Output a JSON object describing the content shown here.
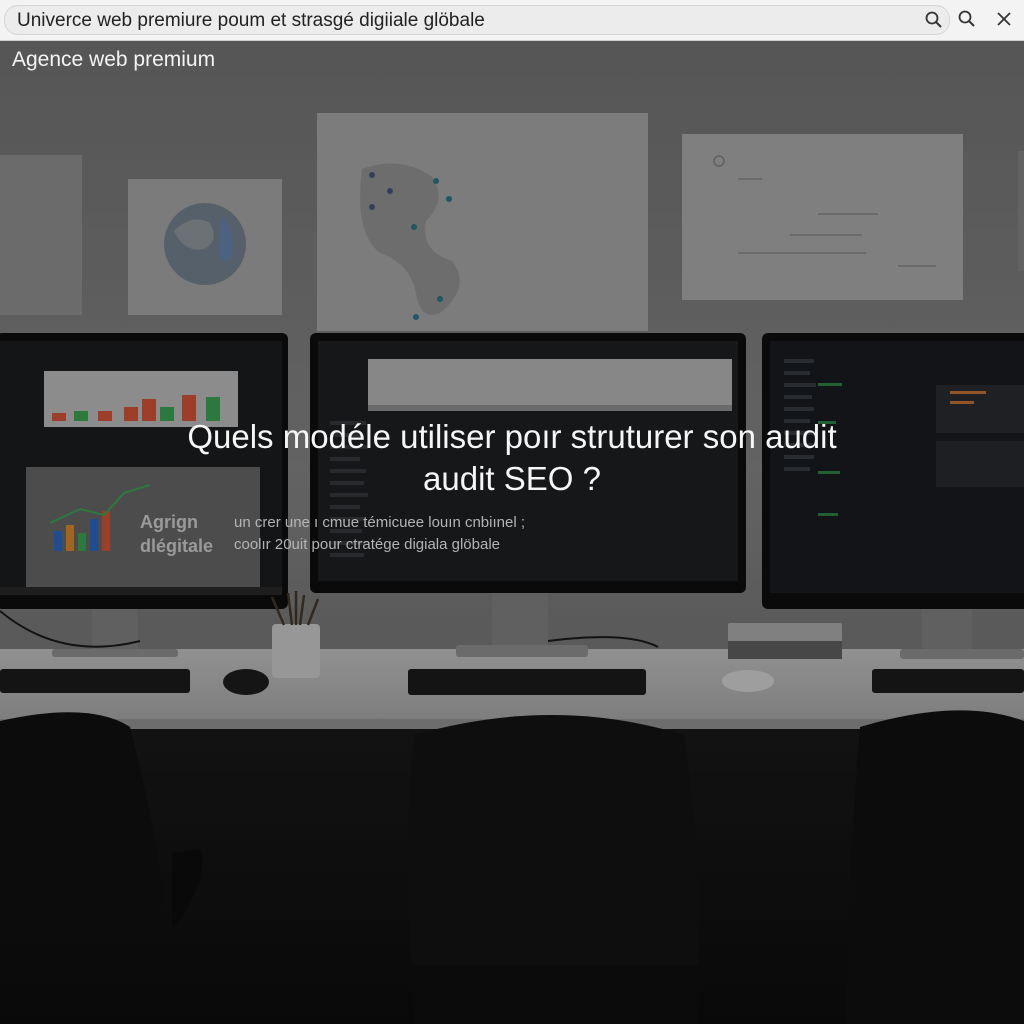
{
  "search": {
    "value": "Univerce web premiure poum et strasgé digiiale glöbale"
  },
  "icons": {
    "search_inline": "search-icon",
    "search_button": "search-icon",
    "close": "close-icon"
  },
  "hero": {
    "brand": "Agence web premium",
    "headline_line1": "Quels modéle utiliser poır struturer son audit",
    "headline_line2": "audit SEO ?",
    "panel_title_line1": "Agrign",
    "panel_title_line2": "dlégitale",
    "panel_sub_line1": "un crer une ı cmue témicuee louın cnbiınel ;",
    "panel_sub_line2": "coolır 20uit    pour ctratége digiala glöbale"
  },
  "colors": {
    "topbar": "#f3f3f3",
    "overlay": "#000000",
    "chart_red": "#e05a3a",
    "chart_green": "#3fae5a",
    "chart_blue": "#2e6fd1",
    "chart_orange": "#e8902c"
  }
}
